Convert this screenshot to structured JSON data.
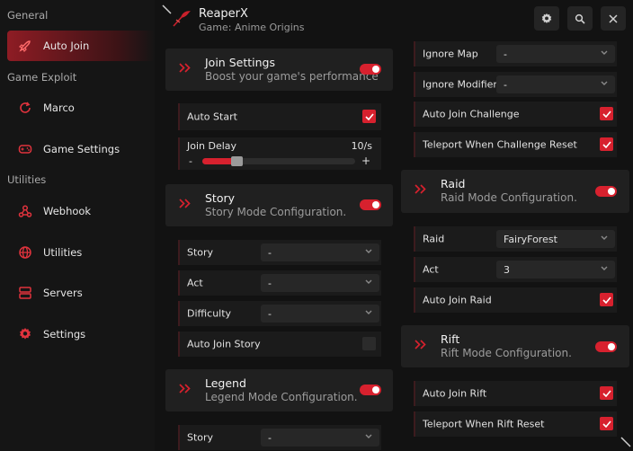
{
  "app": {
    "title": "ReaperX",
    "subtitle": "Game: Anime Origins"
  },
  "sidebar": {
    "sections": [
      "General",
      "Game Exploit",
      "Utilities"
    ],
    "items": [
      {
        "label": "Auto Join",
        "icon": "rocket-icon",
        "active": true
      },
      {
        "label": "Marco",
        "icon": "refresh-icon"
      },
      {
        "label": "Game Settings",
        "icon": "gamepad-icon"
      },
      {
        "label": "Webhook",
        "icon": "webhook-icon"
      },
      {
        "label": "Utilities",
        "icon": "globe-icon"
      },
      {
        "label": "Servers",
        "icon": "server-icon"
      },
      {
        "label": "Settings",
        "icon": "gear-icon"
      }
    ]
  },
  "header_buttons": [
    "settings-icon",
    "search-icon",
    "close-icon"
  ],
  "colors": {
    "accent": "#d7212e",
    "background": "#121212",
    "panel": "#202020"
  },
  "left": {
    "join_settings": {
      "title": "Join Settings",
      "subtitle": "Boost your game's performance",
      "enabled": true
    },
    "auto_start": {
      "label": "Auto Start",
      "checked": true
    },
    "join_delay": {
      "label": "Join Delay",
      "value": "10/s",
      "minus": "-",
      "plus": "+",
      "fraction": 0.19
    },
    "story": {
      "title": "Story",
      "subtitle": "Story Mode Configuration.",
      "enabled": true
    },
    "story_rows": [
      {
        "label": "Story",
        "value": "-"
      },
      {
        "label": "Act",
        "value": "-"
      },
      {
        "label": "Difficulty",
        "value": "-"
      }
    ],
    "auto_join_story": {
      "label": "Auto Join Story",
      "checked": false
    },
    "legend": {
      "title": "Legend",
      "subtitle": "Legend Mode Configuration.",
      "enabled": true
    },
    "legend_story": {
      "label": "Story",
      "value": "-"
    }
  },
  "right": {
    "ignore_map": {
      "label": "Ignore Map",
      "value": "-"
    },
    "ignore_modifier": {
      "label": "Ignore Modifier",
      "value": "-"
    },
    "auto_join_challenge": {
      "label": "Auto Join Challenge",
      "checked": true
    },
    "teleport_challenge": {
      "label": "Teleport When Challenge Reset",
      "checked": true
    },
    "raid": {
      "title": "Raid",
      "subtitle": "Raid Mode Configuration.",
      "enabled": true
    },
    "raid_select": {
      "label": "Raid",
      "value": "FairyForest"
    },
    "act_select": {
      "label": "Act",
      "value": "3"
    },
    "auto_join_raid": {
      "label": "Auto Join Raid",
      "checked": true
    },
    "rift": {
      "title": "Rift",
      "subtitle": "Rift Mode Configuration.",
      "enabled": true
    },
    "auto_join_rift": {
      "label": "Auto Join Rift",
      "checked": true
    },
    "teleport_rift": {
      "label": "Teleport When Rift Reset",
      "checked": true
    }
  }
}
